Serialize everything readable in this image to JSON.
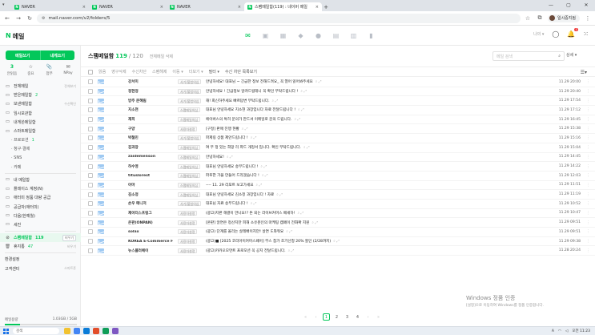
{
  "browser": {
    "tabs": [
      {
        "label": "NAVER",
        "active": false
      },
      {
        "label": "NAVER",
        "active": false
      },
      {
        "label": "NAVER",
        "active": false
      },
      {
        "label": "스팸메일함(119) : 네이버 메일",
        "active": true
      }
    ],
    "url": "mail.naver.com/v2/folders/5",
    "profile_label": "일시중지됨"
  },
  "header": {
    "logo_n": "N",
    "logo_text": "메일",
    "user_text": "나의 ▾",
    "notif_count": "1"
  },
  "sidebar": {
    "compose_label": "메일쓰기",
    "to_me_label": "내게쓰기",
    "quick": [
      {
        "count": "3",
        "icon": "",
        "label": "안읽음"
      },
      {
        "count": "",
        "icon": "☆",
        "label": "중요"
      },
      {
        "count": "",
        "icon": "📎",
        "label": "첨부"
      },
      {
        "count": "",
        "icon": "✉",
        "label": "NPay"
      }
    ],
    "items": [
      {
        "icon": "▭",
        "label": "전체메일",
        "count": "",
        "action": "전체보기"
      },
      {
        "icon": "▭",
        "label": "받은메일함",
        "count": "2",
        "action": ""
      },
      {
        "icon": "▭",
        "label": "보낸메일함",
        "count": "",
        "action": "수신확인"
      },
      {
        "icon": "▭",
        "label": "임시보관함",
        "count": "",
        "action": ""
      },
      {
        "icon": "▭",
        "label": "내게쓴메일함",
        "count": "",
        "action": ""
      },
      {
        "icon": "▭",
        "label": "스마트메일함",
        "count": "",
        "action": ""
      },
      {
        "icon": "",
        "label": "· 프로모션",
        "count": "1",
        "action": "",
        "sub": true
      },
      {
        "icon": "",
        "label": "· 청구·결제",
        "count": "",
        "action": "",
        "sub": true
      },
      {
        "icon": "",
        "label": "· SNS",
        "count": "",
        "action": "",
        "sub": true
      },
      {
        "icon": "",
        "label": "· 카페",
        "count": "",
        "action": "",
        "sub": true
      },
      {
        "icon": "▭",
        "label": "내 메일함",
        "count": "",
        "action": ""
      },
      {
        "icon": "▭",
        "label": "플레이스 계정(N)",
        "count": "",
        "action": ""
      },
      {
        "icon": "▭",
        "label": "애터미 정품 대량 공급",
        "count": "",
        "action": ""
      },
      {
        "icon": "▭",
        "label": "공급자(애터미)",
        "count": "",
        "action": ""
      },
      {
        "icon": "▭",
        "label": "다움(한예월)",
        "count": "",
        "action": ""
      },
      {
        "icon": "▭",
        "label": "세진",
        "count": "",
        "action": ""
      }
    ],
    "spam": {
      "label": "스팸메일함",
      "count": "119",
      "action": "비우기"
    },
    "trash": {
      "label": "휴지통",
      "count": "47",
      "action": "비우기"
    },
    "settings_label": "환경설정",
    "support_label": "고객센터",
    "support_action": "스마트폰",
    "storage_label": "메일용량",
    "storage_value": "1.03GB / 5GB",
    "storage_fraction": 0.21
  },
  "main": {
    "title": "스팸메일함",
    "count": "119",
    "total": "/ 120",
    "delete_all": "전체메일 삭제",
    "search_placeholder": "메일 검색",
    "advanced": "상세 ▾",
    "toolbar": [
      "읽음",
      "영구삭제",
      "수신차단",
      "스팸해제",
      "이동 ▾",
      "더보기 ▾",
      "필터 ▾",
      "수신 차단 목록보기"
    ],
    "rows": [
      {
        "sender": "강서미",
        "tag": "사기/불법의심",
        "subject": "안녕하세요! 대표님 ~ 긴급한 정보 전해드려요_ 꼭 열어 읽어봐주세요",
        "date": "11.29 20:00"
      },
      {
        "sender": "정현정",
        "tag": "사기/불법의심",
        "subject": "안녕하세요 ! 긴급정보 알려드릴테니 꼭 확인 부탁드립니다 !",
        "date": "11.29 20:40"
      },
      {
        "sender": "방주 문혜림",
        "tag": "사기/불법의심",
        "subject": "해! 회신하주세요 빠르답변 부탁드립니다.",
        "date": "11.29 17:54"
      },
      {
        "sender": "지소현",
        "tag": "스팸메일의심",
        "subject": "대표님 안녕하세요 지소현 과장입니다 자료 전달드립니다 !",
        "date": "11.29 17:12"
      },
      {
        "sender": "재희",
        "tag": "스팸메일의심",
        "subject": "에이버스의 특히 문의가 만드셔 이메일로 문의 드립니다.",
        "date": "11.29 16:45"
      },
      {
        "sender": "구양",
        "tag": "사용자설정",
        "subject": "[구정] 판매 진행 현황",
        "date": "11.29 15:38"
      },
      {
        "sender": "박철민",
        "tag": "사기/불법의심",
        "subject": "파제링 상품 제안드립니다 !",
        "date": "11.29 15:16"
      },
      {
        "sender": "김과장",
        "tag": "스팸메일의심",
        "subject": "여 부 정 있는 희망 리 파드 개정서 입니다. 확인 부탁드립니다.",
        "date": "11.29 15:04"
      },
      {
        "sender": "zaidemenson",
        "tag": "스팸메일의심",
        "subject": "안녕하세요!",
        "date": "11.29 14:45"
      },
      {
        "sender": "하수영",
        "tag": "스팸메일의심",
        "subject": "대표님 안녕하세요 송부드립니다 !",
        "date": "11.29 14:22"
      },
      {
        "sender": "tituslorest",
        "tag": "스팸메일의심",
        "subject": "파푸한 가을 만들어 드리겠습니다 !",
        "date": "11.29 12:03"
      },
      {
        "sender": "아마",
        "tag": "스팸메일의심",
        "subject": "---- 11. 29 리포트 보고가세요",
        "date": "11.29 11:51"
      },
      {
        "sender": "김소정",
        "tag": "스팸메일의심",
        "subject": "대표님 안녕하세요 김소정 과장입니다 ! 자료",
        "date": "11.29 11:19"
      },
      {
        "sender": "손우 메니저",
        "tag": "사기/불법의심",
        "subject": "대표님 자료 송부드립니다 !",
        "date": "11.29 10:52"
      },
      {
        "sender": "제이터스프링그",
        "tag": "사용자설정",
        "subject": "(광고)지판 해결이 만나요!? 돈 되는 라이브커머스 배세하!",
        "date": "11.29 10:47"
      },
      {
        "sender": "온판(ONPAN)",
        "tag": "사용자설정",
        "subject": "[온판] 알면은 정산치만 피해 소유분인의 마케팅 캠페이 전화확 지원",
        "date": "11.29 09:51"
      },
      {
        "sender": "solax",
        "tag": "사용자설정",
        "subject": "(광고) 단계를 올리는 살레배이지만! 살면 도와줘요",
        "date": "11.29 09:51"
      },
      {
        "sender": "KOREA E-Commerce Fair",
        "tag": "사용자설정",
        "subject": "(광고)■ [2025 코리아이커머스페어] 부스 참가 조기신청 20% 할인 (2/28까지)",
        "date": "11.29 09:38"
      },
      {
        "sender": "뉴스플러페이",
        "tag": "사용자설정",
        "subject": "(광고)카카오모먼트 프로모션 꼭 공지 전달드립니다.",
        "date": "11.28 20:24"
      }
    ],
    "pages": [
      "«",
      "‹",
      "1",
      "2",
      "3",
      "4",
      "›",
      "»"
    ],
    "current_page": "1"
  },
  "watermark": {
    "line1": "Windows 정품 인증",
    "line2": "[설정]으로 이동하여 Windows를 정품 인증합니다."
  },
  "taskbar": {
    "search_placeholder": "검색",
    "time": "오전 11:23",
    "lang": "A"
  },
  "colors": {
    "brand": "#03c75a",
    "envelope": "#9ec9f2"
  }
}
